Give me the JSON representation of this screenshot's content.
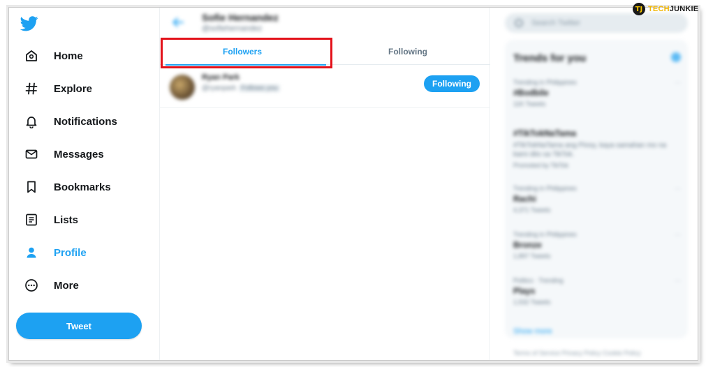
{
  "brand": {
    "accent": "#1da1f2",
    "highlight": "#e3121b"
  },
  "sidebar": {
    "items": [
      {
        "label": "Home",
        "icon": "home-icon"
      },
      {
        "label": "Explore",
        "icon": "hashtag-icon"
      },
      {
        "label": "Notifications",
        "icon": "bell-icon"
      },
      {
        "label": "Messages",
        "icon": "envelope-icon"
      },
      {
        "label": "Bookmarks",
        "icon": "bookmark-icon"
      },
      {
        "label": "Lists",
        "icon": "list-icon"
      },
      {
        "label": "Profile",
        "icon": "person-icon",
        "active": true
      },
      {
        "label": "More",
        "icon": "more-icon"
      }
    ],
    "tweet_label": "Tweet"
  },
  "header": {
    "name": "Sofie Hernandez",
    "handle": "@sofiehernandez"
  },
  "tabs": {
    "followers": "Followers",
    "following": "Following",
    "active": "followers"
  },
  "followers_list": [
    {
      "name": "Ryan Park",
      "handle": "@ryanpark",
      "follows_you": "Follows you",
      "button": "Following"
    }
  ],
  "right": {
    "search_placeholder": "Search Twitter",
    "trends_title": "Trends for you",
    "trends": [
      {
        "meta": "Trending in Philippines",
        "name": "#Bodbile",
        "count": "11K Tweets",
        "dismiss": "···"
      },
      {
        "meta": "",
        "name": "#TikTokNaTama",
        "desc": "#TikTokNaTama ang Pinoy, kaya samahan mo na kami dito sa TikTok.",
        "count": "Promoted by TikTok",
        "dismiss": ""
      },
      {
        "meta": "Trending in Philippines",
        "name": "Rachi",
        "count": "4,371 Tweets",
        "dismiss": "···"
      },
      {
        "meta": "Trending in Philippines",
        "name": "Bronze",
        "count": "1,897 Tweets",
        "dismiss": "···"
      },
      {
        "meta": "Politics · Trending",
        "name": "Plays",
        "count": "1,532 Tweets",
        "dismiss": "···"
      }
    ],
    "show_more": "Show more",
    "footer": "Terms of Service   Privacy Policy   Cookie Policy"
  },
  "watermark": {
    "letter": "TJ",
    "prefix": "TECH",
    "suffix": "JUNKIE"
  }
}
